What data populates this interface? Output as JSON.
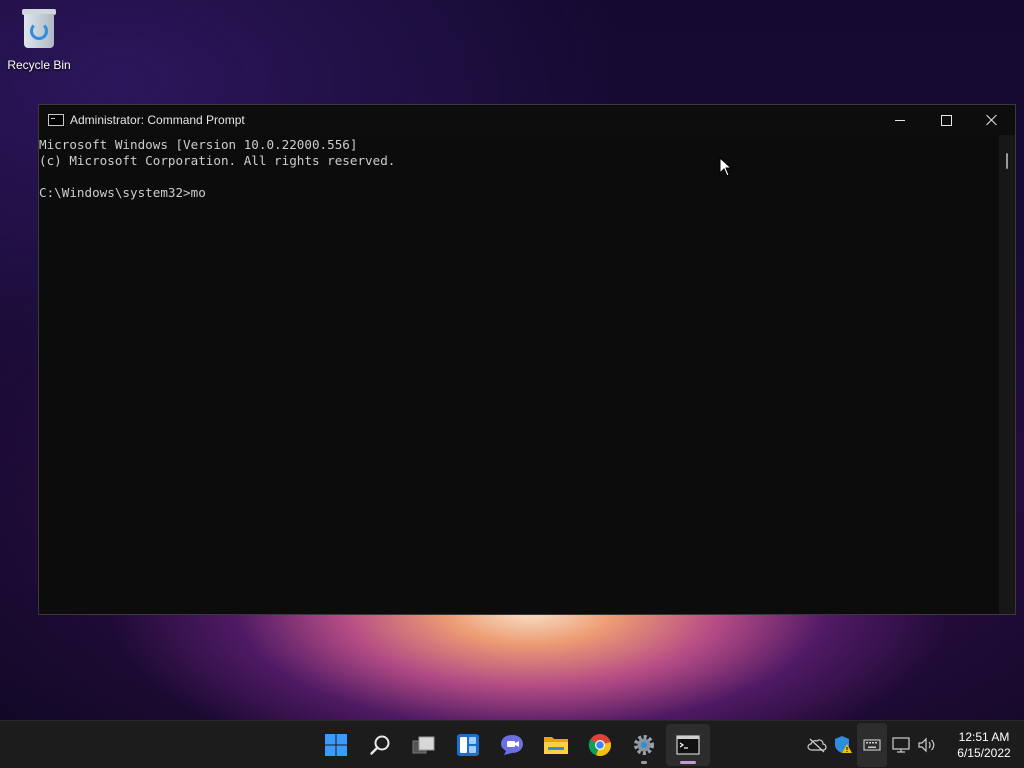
{
  "desktop": {
    "icons": [
      {
        "label": "Recycle Bin",
        "icon": "recycle-bin-icon"
      }
    ]
  },
  "window": {
    "title": "Administrator: Command Prompt",
    "icon": "cmd-icon",
    "controls": {
      "minimize": "minimize-icon",
      "maximize": "maximize-icon",
      "close": "close-icon"
    },
    "console": {
      "line1": "Microsoft Windows [Version 10.0.22000.556]",
      "line2": "(c) Microsoft Corporation. All rights reserved.",
      "line3": "",
      "prompt": "C:\\Windows\\system32>",
      "input": "mo"
    }
  },
  "taskbar": {
    "apps": [
      {
        "name": "start",
        "icon": "windows-start-icon"
      },
      {
        "name": "search",
        "icon": "search-icon"
      },
      {
        "name": "task-view",
        "icon": "task-view-icon"
      },
      {
        "name": "widgets",
        "icon": "widgets-icon"
      },
      {
        "name": "chat",
        "icon": "chat-icon"
      },
      {
        "name": "file-explorer",
        "icon": "folder-icon"
      },
      {
        "name": "chrome",
        "icon": "chrome-icon"
      },
      {
        "name": "settings",
        "icon": "gear-icon"
      },
      {
        "name": "command-prompt",
        "icon": "cmd-icon"
      }
    ],
    "tray": {
      "icons": [
        "onedrive-offline-icon",
        "security-warning-icon",
        "keyboard-icon",
        "network-icon",
        "volume-icon"
      ],
      "time": "12:51 AM",
      "date": "6/15/2022"
    }
  },
  "colors": {
    "terminal_bg": "#0c0c0c",
    "terminal_text": "#cccccc",
    "taskbar_bg": "#1c1c1c",
    "accent": "#3a9bff"
  }
}
